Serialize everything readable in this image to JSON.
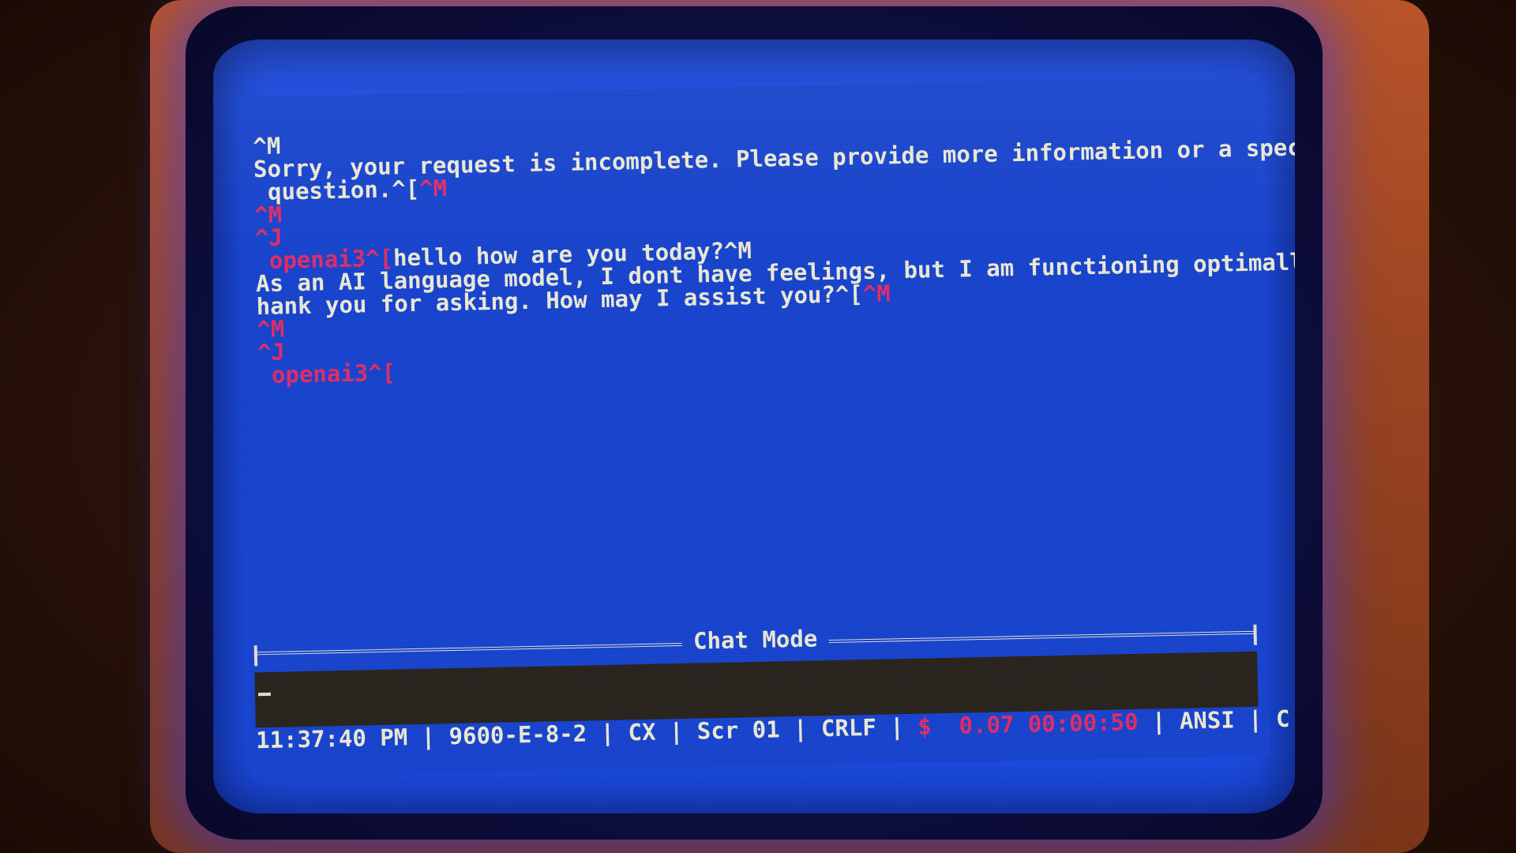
{
  "terminal": {
    "lines": [
      {
        "text": "^M",
        "ctrl": ""
      },
      {
        "text": "Sorry, your request is incomplete. Please provide more information or a specific",
        "ctrl": ""
      },
      {
        "text": " question.^[",
        "ctrl": "^M"
      },
      {
        "text": "",
        "ctrl": "^M"
      },
      {
        "text": "",
        "ctrl": "^J"
      },
      {
        "text": "",
        "ctrl": " openai3^[",
        "after": "hello how are you today?^M"
      },
      {
        "text": "As an AI language model, I dont have feelings, but I am functioning optimally. T",
        "ctrl": ""
      },
      {
        "text": "hank you for asking. How may I assist you?^[",
        "ctrl": "^M"
      },
      {
        "text": "",
        "ctrl": "^M"
      },
      {
        "text": "",
        "ctrl": "^J"
      },
      {
        "text": "",
        "ctrl": " openai3^["
      }
    ]
  },
  "status": {
    "title": "Chat Mode",
    "time": "11:37:40 PM",
    "serial": "9600-E-8-2",
    "cx": "CX",
    "screen": "Scr 01",
    "line_ending": "CRLF",
    "cost_symbol": "$",
    "cost": "0.07",
    "elapsed": "00:00:50",
    "emulation": "ANSI",
    "last": "C"
  },
  "colors": {
    "screen_bg": "#1a47d4",
    "text": "#f2f0dc",
    "control_chars": "#e8306a",
    "input_bar": "#2b2620"
  }
}
